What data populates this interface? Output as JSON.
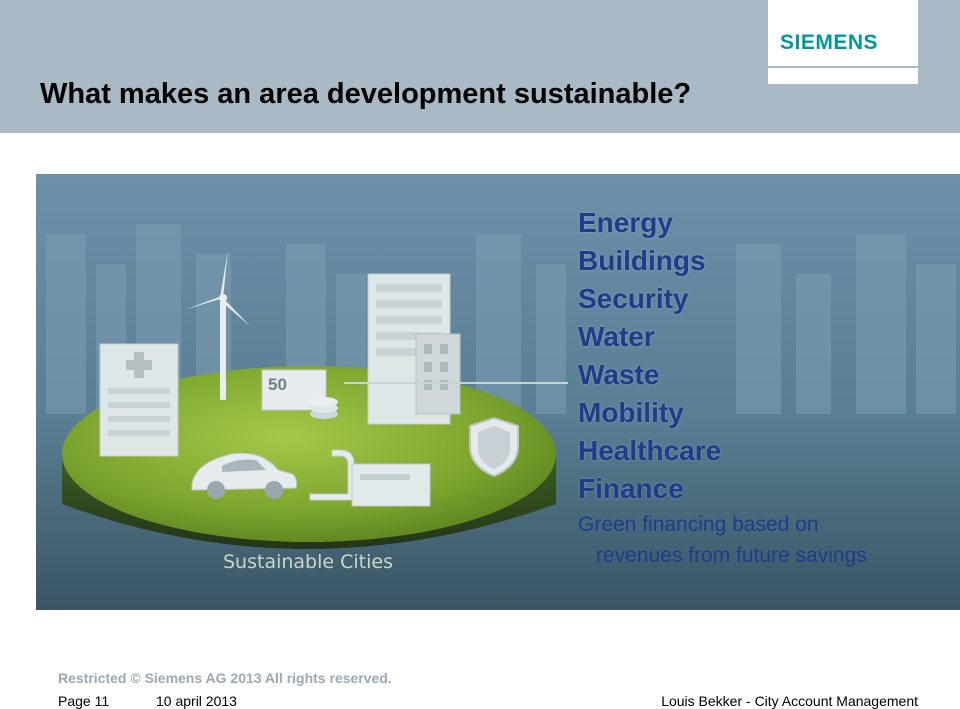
{
  "slide": {
    "title": "What makes an area development sustainable?",
    "brand": "SIEMENS",
    "colors": {
      "header_bg": "#a9b9c6",
      "brand": "#009999",
      "list_text": "#1f3b8c",
      "platform_green": "#7aa52d"
    }
  },
  "image": {
    "platform_label": "Sustainable Cities",
    "banknote_value": "50",
    "icons": [
      "wind-turbine-icon",
      "hospital-building-icon",
      "office-building-icon",
      "money-icon",
      "car-icon",
      "shield-icon",
      "water-tap-icon"
    ]
  },
  "list": {
    "items": [
      "Energy",
      "Buildings",
      "Security",
      "Water",
      "Waste",
      "Mobility",
      "Healthcare",
      "Finance"
    ],
    "sub_line1": "Green financing based on",
    "sub_line2": "revenues from future savings"
  },
  "footer": {
    "restricted": "Restricted © Siemens AG 2013 All rights reserved.",
    "page": "Page 11",
    "date": "10 april 2013",
    "author": "Louis Bekker - City Account Management"
  }
}
